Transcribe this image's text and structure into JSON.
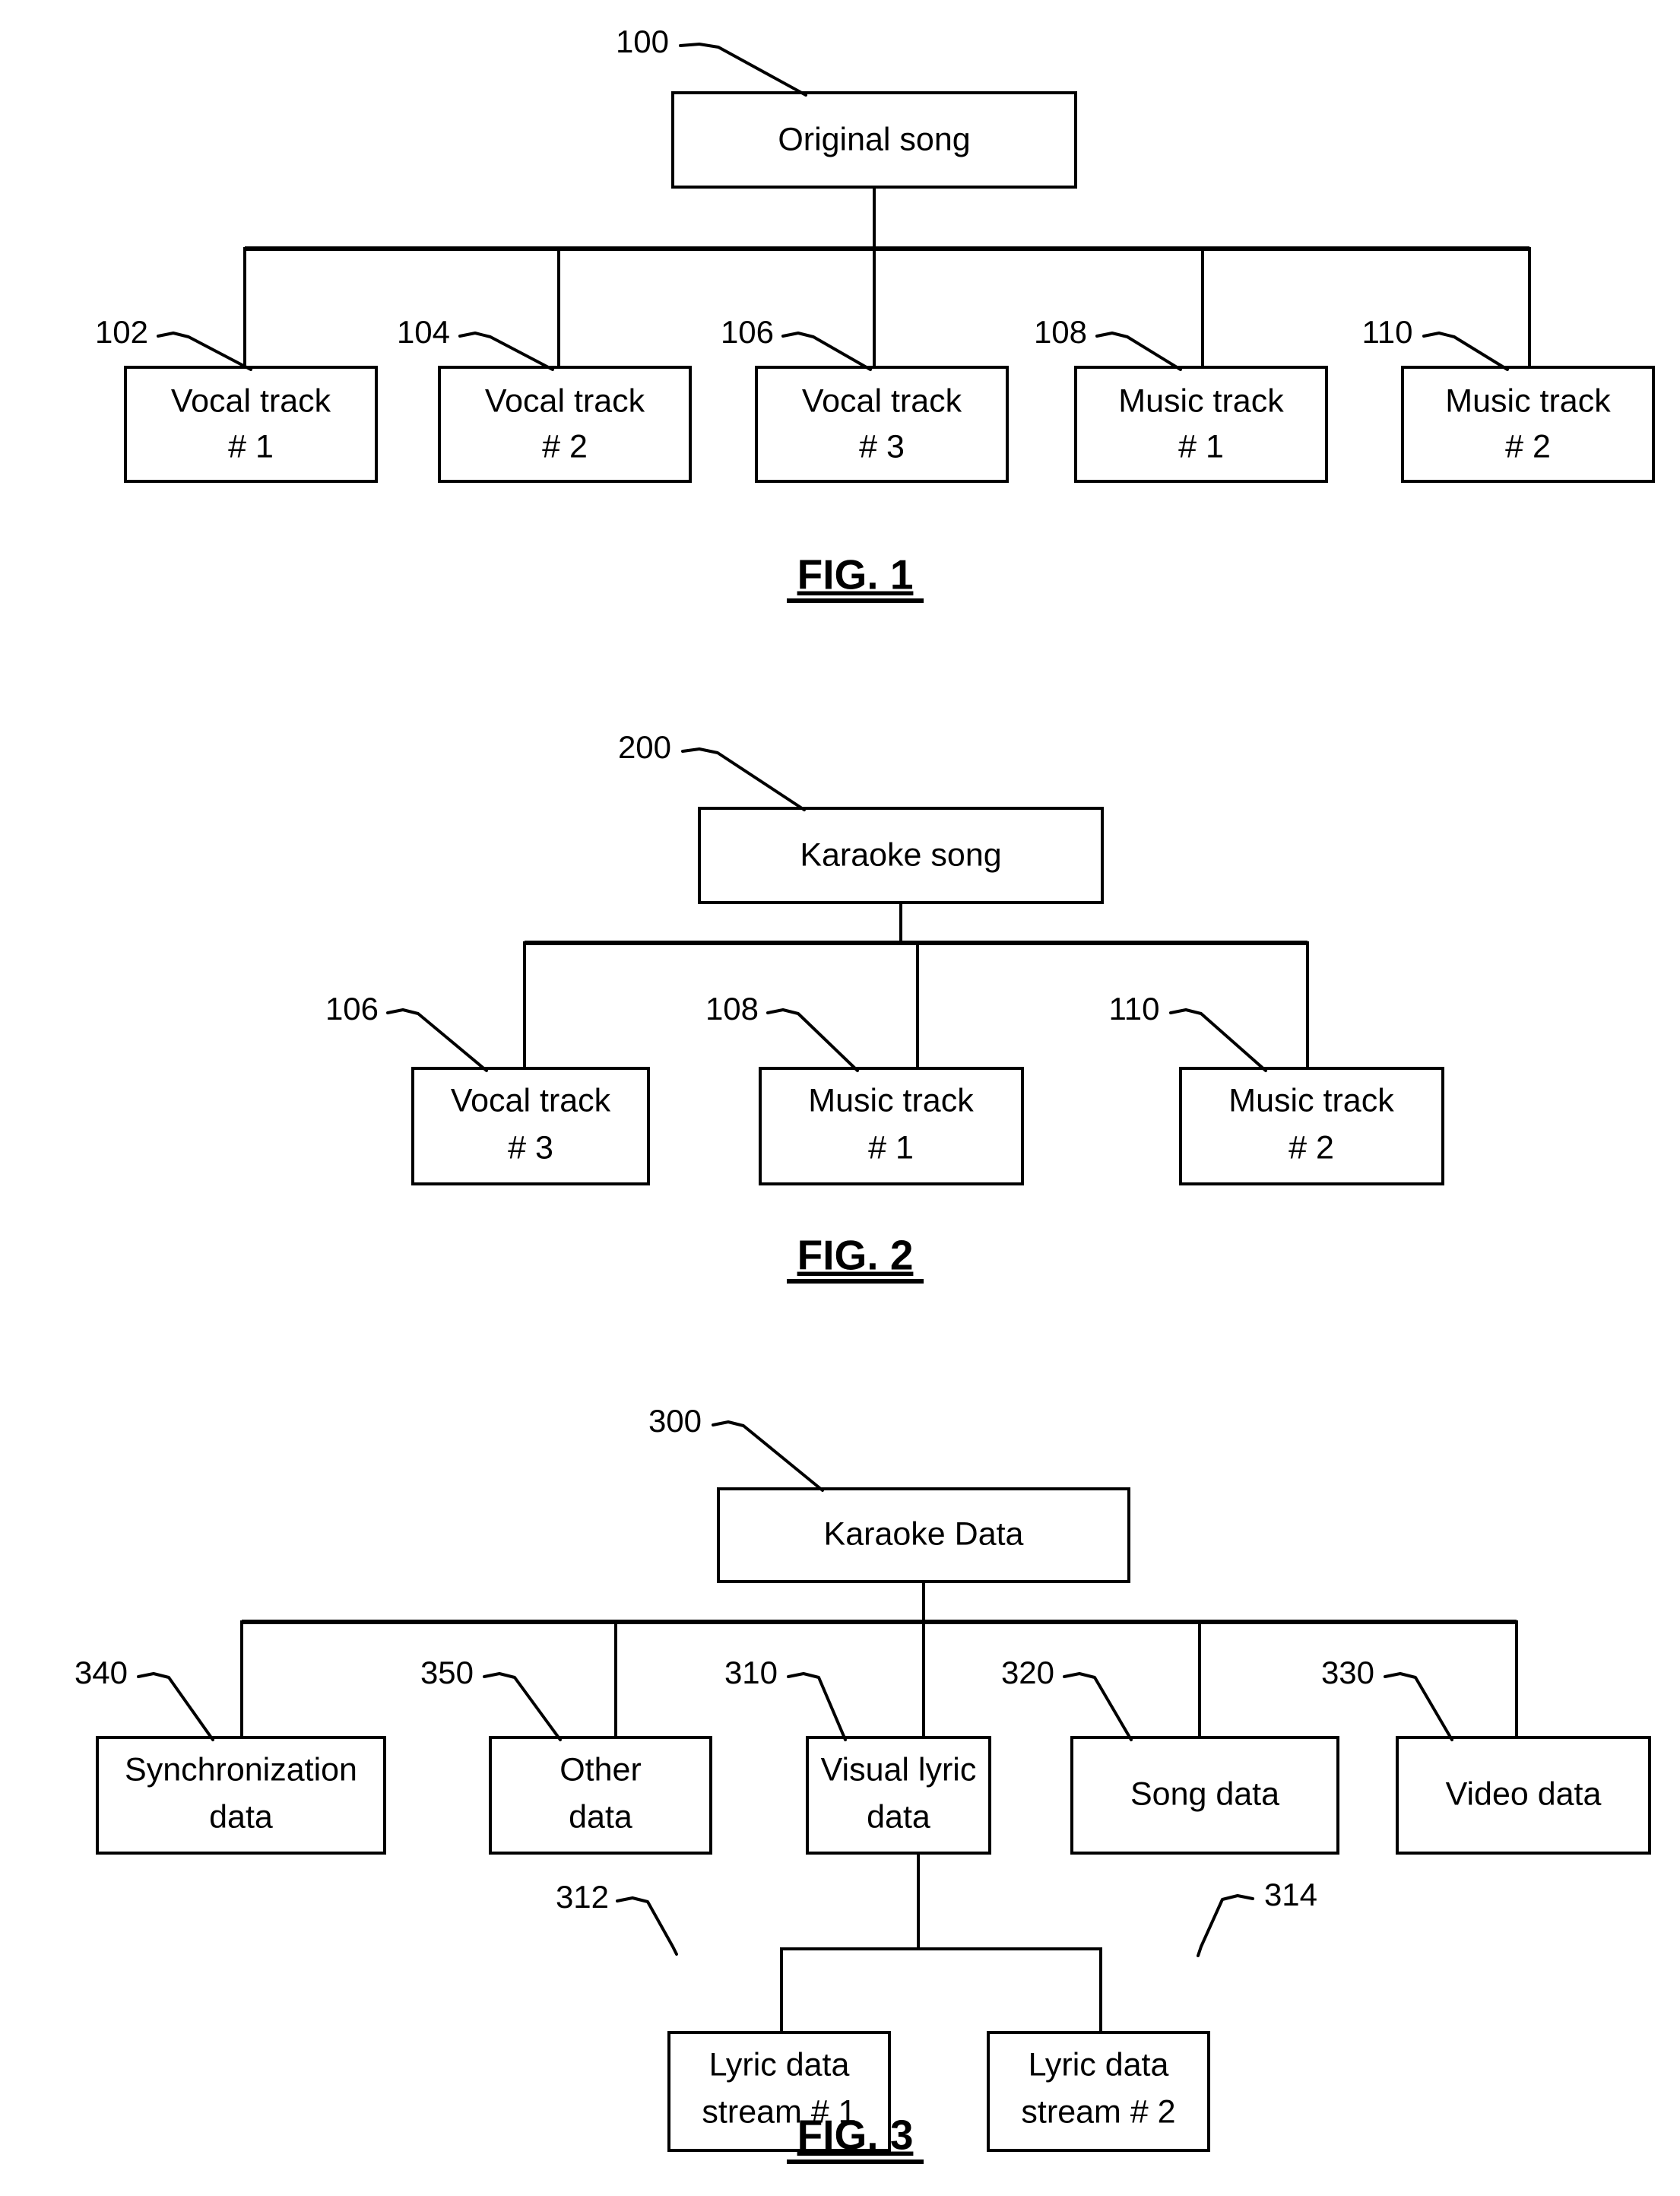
{
  "document": {
    "type": "patent-figure-sheet",
    "figures": [
      {
        "id": "fig1",
        "caption": "FIG. 1",
        "root": {
          "ref": "100",
          "label_line1": "Original song",
          "label_line2": ""
        },
        "children": [
          {
            "ref": "102",
            "label_line1": "Vocal track",
            "label_line2": "# 1"
          },
          {
            "ref": "104",
            "label_line1": "Vocal track",
            "label_line2": "# 2"
          },
          {
            "ref": "106",
            "label_line1": "Vocal track",
            "label_line2": "# 3"
          },
          {
            "ref": "108",
            "label_line1": "Music track",
            "label_line2": "# 1"
          },
          {
            "ref": "110",
            "label_line1": "Music track",
            "label_line2": "# 2"
          }
        ]
      },
      {
        "id": "fig2",
        "caption": "FIG. 2",
        "root": {
          "ref": "200",
          "label_line1": "Karaoke song",
          "label_line2": ""
        },
        "children": [
          {
            "ref": "106",
            "label_line1": "Vocal track",
            "label_line2": "# 3"
          },
          {
            "ref": "108",
            "label_line1": "Music track",
            "label_line2": "# 1"
          },
          {
            "ref": "110",
            "label_line1": "Music track",
            "label_line2": "# 2"
          }
        ]
      },
      {
        "id": "fig3",
        "caption": "FIG. 3",
        "root": {
          "ref": "300",
          "label_line1": "Karaoke Data",
          "label_line2": ""
        },
        "children": [
          {
            "ref": "340",
            "label_line1": "Synchronization",
            "label_line2": "data"
          },
          {
            "ref": "350",
            "label_line1": "Other",
            "label_line2": "data"
          },
          {
            "ref": "310",
            "label_line1": "Visual lyric",
            "label_line2": "data"
          },
          {
            "ref": "320",
            "label_line1": "Song data",
            "label_line2": ""
          },
          {
            "ref": "330",
            "label_line1": "Video data",
            "label_line2": ""
          }
        ],
        "grandchildren": [
          {
            "ref": "312",
            "label_line1": "Lyric data",
            "label_line2": "stream # 1"
          },
          {
            "ref": "314",
            "label_line1": "Lyric data",
            "label_line2": "stream # 2"
          }
        ]
      }
    ],
    "colors": {
      "ink": "#000000",
      "paper": "#ffffff"
    }
  }
}
